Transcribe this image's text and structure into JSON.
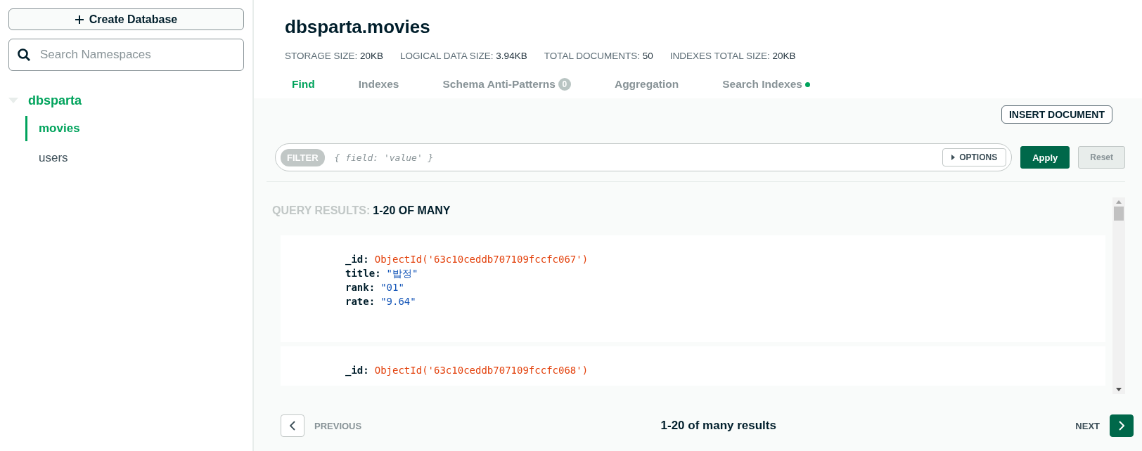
{
  "sidebar": {
    "create_button": "Create Database",
    "search": {
      "placeholder": "Search Namespaces"
    },
    "tree": [
      {
        "label": "dbsparta",
        "expanded": true,
        "selected": false,
        "children": [
          {
            "label": "movies",
            "selected": true
          },
          {
            "label": "users",
            "selected": false
          }
        ]
      }
    ]
  },
  "header": {
    "title": "dbsparta.movies",
    "stats": [
      {
        "label": "STORAGE SIZE:",
        "value": "20KB"
      },
      {
        "label": "LOGICAL DATA SIZE:",
        "value": "3.94KB"
      },
      {
        "label": "TOTAL DOCUMENTS:",
        "value": "50"
      },
      {
        "label": "INDEXES TOTAL SIZE:",
        "value": "20KB"
      }
    ],
    "tabs": [
      {
        "label": "Find",
        "selected": true,
        "dot": false
      },
      {
        "label": "Indexes",
        "selected": false,
        "dot": false
      },
      {
        "label": "Schema Anti-Patterns",
        "selected": false,
        "badge": "0",
        "dot": false
      },
      {
        "label": "Aggregation",
        "selected": false,
        "dot": false
      },
      {
        "label": "Search Indexes",
        "selected": false,
        "dot": true
      }
    ]
  },
  "toolbar": {
    "insert_button": "INSERT DOCUMENT"
  },
  "query_bar": {
    "filter_label": "FILTER",
    "placeholder": "{ field: 'value' }",
    "options_button": "OPTIONS",
    "apply_button": "Apply",
    "reset_button": "Reset",
    "reset_disabled": true
  },
  "results": {
    "label": "QUERY RESULTS:",
    "range": "1-20 OF MANY",
    "documents": [
      {
        "fields": [
          {
            "key": "_id:",
            "value": "ObjectId('63c10ceddb707109fccfc067')",
            "kind": "objectid"
          },
          {
            "key": "title:",
            "value": "\"밥정\"",
            "kind": "string"
          },
          {
            "key": "rank:",
            "value": "\"01\"",
            "kind": "string"
          },
          {
            "key": "rate:",
            "value": "\"9.64\"",
            "kind": "string"
          }
        ]
      },
      {
        "fields": [
          {
            "key": "_id:",
            "value": "ObjectId('63c10ceddb707109fccfc068')",
            "kind": "objectid"
          }
        ]
      }
    ]
  },
  "pagination": {
    "previous": "PREVIOUS",
    "summary": "1-20 of many results",
    "next": "NEXT"
  }
}
